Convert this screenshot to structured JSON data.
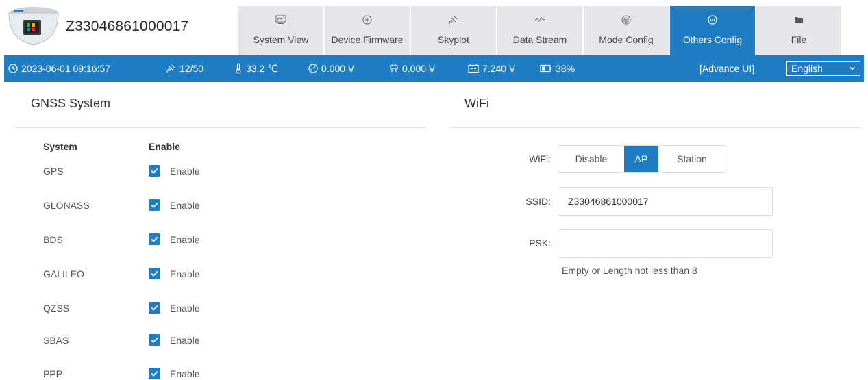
{
  "header": {
    "serial": "Z33046861000017",
    "device_image": "gnss-receiver-image",
    "tabs": [
      {
        "label": "System View",
        "icon": "monitor-icon",
        "active": false
      },
      {
        "label": "Device Firmware",
        "icon": "circle-plus-icon",
        "active": false
      },
      {
        "label": "Skyplot",
        "icon": "satellite-icon",
        "active": false
      },
      {
        "label": "Data Stream",
        "icon": "wave-icon",
        "active": false
      },
      {
        "label": "Mode Config",
        "icon": "cube-icon",
        "active": false
      },
      {
        "label": "Others Config",
        "icon": "ellipsis-circle-icon",
        "active": true
      },
      {
        "label": "File",
        "icon": "folder-icon",
        "active": false
      }
    ]
  },
  "status": {
    "datetime": "2023-06-01 09:16:57",
    "satellites": "12/50",
    "temperature": "33.2 ℃",
    "voltage1": "0.000 V",
    "voltage2": "0.000 V",
    "voltage3": "7.240 V",
    "battery": "38%",
    "advance_ui": "[Advance UI]",
    "language": "English"
  },
  "gnss": {
    "title": "GNSS System",
    "col_system": "System",
    "col_enable": "Enable",
    "systems": [
      {
        "name": "GPS",
        "enable_label": "Enable",
        "enabled": true
      },
      {
        "name": "GLONASS",
        "enable_label": "Enable",
        "enabled": true
      },
      {
        "name": "BDS",
        "enable_label": "Enable",
        "enabled": true
      },
      {
        "name": "GALILEO",
        "enable_label": "Enable",
        "enabled": true
      },
      {
        "name": "QZSS",
        "enable_label": "Enable",
        "enabled": true
      },
      {
        "name": "SBAS",
        "enable_label": "Enable",
        "enabled": true
      },
      {
        "name": "PPP",
        "enable_label": "Enable",
        "enabled": true
      }
    ]
  },
  "wifi": {
    "title": "WiFi",
    "mode_label": "WiFi:",
    "modes": [
      "Disable",
      "AP",
      "Station"
    ],
    "selected_mode": "AP",
    "ssid_label": "SSID:",
    "ssid_value": "Z33046861000017",
    "psk_label": "PSK:",
    "psk_value": "",
    "psk_hint": "Empty or Length not less than 8"
  },
  "colors": {
    "accent": "#1f7dc6",
    "tab_bg": "#e4e6e9"
  }
}
